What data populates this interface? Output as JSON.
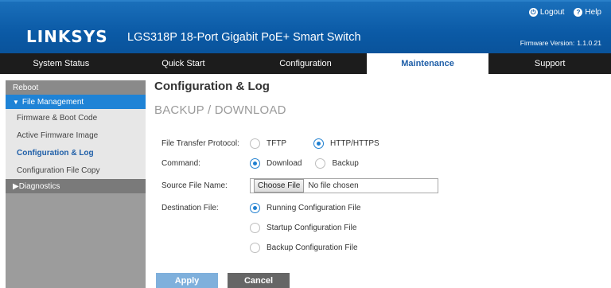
{
  "header": {
    "logo": "LINKSYS",
    "product": "LGS318P 18-Port Gigabit PoE+ Smart Switch",
    "logout": "Logout",
    "help": "Help",
    "firmware_label": "Firmware Version:",
    "firmware_value": "1.1.0.21"
  },
  "nav": [
    "System Status",
    "Quick Start",
    "Configuration",
    "Maintenance",
    "Support"
  ],
  "sidebar": {
    "reboot": "Reboot",
    "file_management": "File Management",
    "sub": [
      "Firmware & Boot Code",
      "Active Firmware Image",
      "Configuration & Log",
      "Configuration File Copy"
    ],
    "diagnostics": "Diagnostics"
  },
  "main": {
    "title": "Configuration & Log",
    "section": "BACKUP / DOWNLOAD",
    "protocol_label": "File Transfer Protocol:",
    "protocol_options": [
      "TFTP",
      "HTTP/HTTPS"
    ],
    "command_label": "Command:",
    "command_options": [
      "Download",
      "Backup"
    ],
    "source_label": "Source File Name:",
    "choose_file": "Choose File",
    "no_file": "No file chosen",
    "destination_label": "Destination File:",
    "destination_options": [
      "Running Configuration File",
      "Startup Configuration File",
      "Backup Configuration File"
    ],
    "apply": "Apply",
    "cancel": "Cancel"
  },
  "colors": {
    "header_blue": "#0b5aa6",
    "accent_blue": "#1f83d6",
    "nav_dark": "#1c1c1c"
  }
}
